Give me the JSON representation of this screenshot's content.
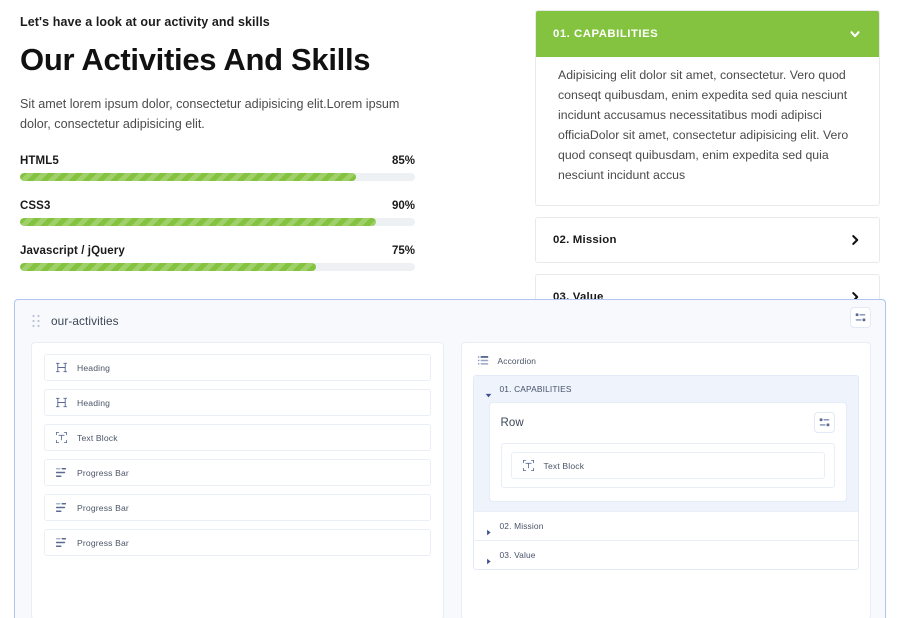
{
  "preview": {
    "eyebrow": "Let's have a look at our activity and skills",
    "title": "Our Activities And Skills",
    "lead": "Sit amet lorem ipsum dolor, consectetur adipisicing elit.Lorem ipsum dolor, consectetur adipisicing elit.",
    "skills": [
      {
        "name": "HTML5",
        "percent_label": "85%",
        "value": 85
      },
      {
        "name": "CSS3",
        "percent_label": "90%",
        "value": 90
      },
      {
        "name": "Javascript / jQuery",
        "percent_label": "75%",
        "value": 75
      }
    ],
    "accordion": [
      {
        "title": "01. CAPABILITIES",
        "state": "expanded",
        "icon": "chevron-down-icon",
        "body": "Adipisicing elit dolor sit amet, consectetur. Vero quod conseqt quibusdam, enim expedita sed quia nesciunt incidunt accusamus necessitatibus modi adipisci officiaDolor sit amet, consectetur adipisicing elit. Vero quod conseqt quibusdam, enim expedita sed quia nesciunt incidunt accus"
      },
      {
        "title": "02. Mission",
        "state": "collapsed",
        "icon": "chevron-right-icon",
        "body": ""
      },
      {
        "title": "03. Value",
        "state": "collapsed",
        "icon": "chevron-right-icon",
        "body": ""
      }
    ]
  },
  "builder": {
    "section_label": "our-activities",
    "drag_handle_icon": "drag-dots-icon",
    "settings_icon": "sliders-icon",
    "left_column": {
      "widgets": [
        {
          "label": "Heading",
          "icon": "heading-icon"
        },
        {
          "label": "Heading",
          "icon": "heading-icon"
        },
        {
          "label": "Text Block",
          "icon": "text-block-icon"
        },
        {
          "label": "Progress Bar",
          "icon": "progress-bar-icon"
        },
        {
          "label": "Progress Bar",
          "icon": "progress-bar-icon"
        },
        {
          "label": "Progress Bar",
          "icon": "progress-bar-icon"
        }
      ]
    },
    "right_column": {
      "widget_label": "Accordion",
      "widget_icon": "accordion-icon",
      "items": [
        {
          "label": "01. CAPABILITIES",
          "state": "expanded",
          "icon": "triangle-down-icon"
        },
        {
          "label": "02. Mission",
          "state": "collapsed",
          "icon": "triangle-right-icon"
        },
        {
          "label": "03. Value",
          "state": "collapsed",
          "icon": "triangle-right-icon"
        }
      ],
      "row": {
        "title": "Row",
        "settings_icon": "sliders-icon",
        "child": {
          "label": "Text Block",
          "icon": "text-block-icon"
        }
      }
    }
  },
  "colors": {
    "accent_green": "#84c340",
    "builder_border_blue": "#aec5f0",
    "builder_bg": "#f7f9fc",
    "icon_blue": "#5a6a93",
    "track_gray": "#eef1f4"
  }
}
